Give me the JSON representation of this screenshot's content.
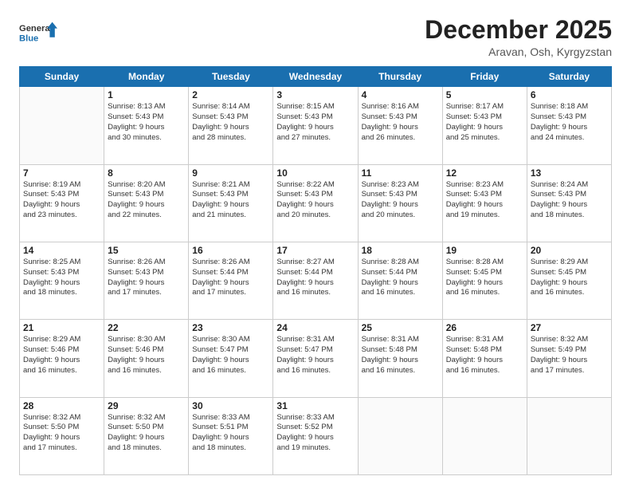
{
  "logo": {
    "line1": "General",
    "line2": "Blue"
  },
  "title": "December 2025",
  "subtitle": "Aravan, Osh, Kyrgyzstan",
  "calendar": {
    "headers": [
      "Sunday",
      "Monday",
      "Tuesday",
      "Wednesday",
      "Thursday",
      "Friday",
      "Saturday"
    ],
    "weeks": [
      [
        {
          "day": "",
          "info": ""
        },
        {
          "day": "1",
          "info": "Sunrise: 8:13 AM\nSunset: 5:43 PM\nDaylight: 9 hours\nand 30 minutes."
        },
        {
          "day": "2",
          "info": "Sunrise: 8:14 AM\nSunset: 5:43 PM\nDaylight: 9 hours\nand 28 minutes."
        },
        {
          "day": "3",
          "info": "Sunrise: 8:15 AM\nSunset: 5:43 PM\nDaylight: 9 hours\nand 27 minutes."
        },
        {
          "day": "4",
          "info": "Sunrise: 8:16 AM\nSunset: 5:43 PM\nDaylight: 9 hours\nand 26 minutes."
        },
        {
          "day": "5",
          "info": "Sunrise: 8:17 AM\nSunset: 5:43 PM\nDaylight: 9 hours\nand 25 minutes."
        },
        {
          "day": "6",
          "info": "Sunrise: 8:18 AM\nSunset: 5:43 PM\nDaylight: 9 hours\nand 24 minutes."
        }
      ],
      [
        {
          "day": "7",
          "info": "Sunrise: 8:19 AM\nSunset: 5:43 PM\nDaylight: 9 hours\nand 23 minutes."
        },
        {
          "day": "8",
          "info": "Sunrise: 8:20 AM\nSunset: 5:43 PM\nDaylight: 9 hours\nand 22 minutes."
        },
        {
          "day": "9",
          "info": "Sunrise: 8:21 AM\nSunset: 5:43 PM\nDaylight: 9 hours\nand 21 minutes."
        },
        {
          "day": "10",
          "info": "Sunrise: 8:22 AM\nSunset: 5:43 PM\nDaylight: 9 hours\nand 20 minutes."
        },
        {
          "day": "11",
          "info": "Sunrise: 8:23 AM\nSunset: 5:43 PM\nDaylight: 9 hours\nand 20 minutes."
        },
        {
          "day": "12",
          "info": "Sunrise: 8:23 AM\nSunset: 5:43 PM\nDaylight: 9 hours\nand 19 minutes."
        },
        {
          "day": "13",
          "info": "Sunrise: 8:24 AM\nSunset: 5:43 PM\nDaylight: 9 hours\nand 18 minutes."
        }
      ],
      [
        {
          "day": "14",
          "info": "Sunrise: 8:25 AM\nSunset: 5:43 PM\nDaylight: 9 hours\nand 18 minutes."
        },
        {
          "day": "15",
          "info": "Sunrise: 8:26 AM\nSunset: 5:43 PM\nDaylight: 9 hours\nand 17 minutes."
        },
        {
          "day": "16",
          "info": "Sunrise: 8:26 AM\nSunset: 5:44 PM\nDaylight: 9 hours\nand 17 minutes."
        },
        {
          "day": "17",
          "info": "Sunrise: 8:27 AM\nSunset: 5:44 PM\nDaylight: 9 hours\nand 16 minutes."
        },
        {
          "day": "18",
          "info": "Sunrise: 8:28 AM\nSunset: 5:44 PM\nDaylight: 9 hours\nand 16 minutes."
        },
        {
          "day": "19",
          "info": "Sunrise: 8:28 AM\nSunset: 5:45 PM\nDaylight: 9 hours\nand 16 minutes."
        },
        {
          "day": "20",
          "info": "Sunrise: 8:29 AM\nSunset: 5:45 PM\nDaylight: 9 hours\nand 16 minutes."
        }
      ],
      [
        {
          "day": "21",
          "info": "Sunrise: 8:29 AM\nSunset: 5:46 PM\nDaylight: 9 hours\nand 16 minutes."
        },
        {
          "day": "22",
          "info": "Sunrise: 8:30 AM\nSunset: 5:46 PM\nDaylight: 9 hours\nand 16 minutes."
        },
        {
          "day": "23",
          "info": "Sunrise: 8:30 AM\nSunset: 5:47 PM\nDaylight: 9 hours\nand 16 minutes."
        },
        {
          "day": "24",
          "info": "Sunrise: 8:31 AM\nSunset: 5:47 PM\nDaylight: 9 hours\nand 16 minutes."
        },
        {
          "day": "25",
          "info": "Sunrise: 8:31 AM\nSunset: 5:48 PM\nDaylight: 9 hours\nand 16 minutes."
        },
        {
          "day": "26",
          "info": "Sunrise: 8:31 AM\nSunset: 5:48 PM\nDaylight: 9 hours\nand 16 minutes."
        },
        {
          "day": "27",
          "info": "Sunrise: 8:32 AM\nSunset: 5:49 PM\nDaylight: 9 hours\nand 17 minutes."
        }
      ],
      [
        {
          "day": "28",
          "info": "Sunrise: 8:32 AM\nSunset: 5:50 PM\nDaylight: 9 hours\nand 17 minutes."
        },
        {
          "day": "29",
          "info": "Sunrise: 8:32 AM\nSunset: 5:50 PM\nDaylight: 9 hours\nand 18 minutes."
        },
        {
          "day": "30",
          "info": "Sunrise: 8:33 AM\nSunset: 5:51 PM\nDaylight: 9 hours\nand 18 minutes."
        },
        {
          "day": "31",
          "info": "Sunrise: 8:33 AM\nSunset: 5:52 PM\nDaylight: 9 hours\nand 19 minutes."
        },
        {
          "day": "",
          "info": ""
        },
        {
          "day": "",
          "info": ""
        },
        {
          "day": "",
          "info": ""
        }
      ]
    ]
  }
}
